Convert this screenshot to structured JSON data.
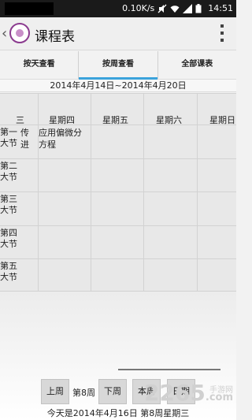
{
  "status_bar": {
    "speed": "0.10K/s",
    "time": "14:51"
  },
  "header": {
    "title": "课程表"
  },
  "tabs": [
    {
      "label": "按天查看"
    },
    {
      "label": "按周查看"
    },
    {
      "label": "全部课表"
    }
  ],
  "date_range": "2014年4月14日~2014年4月20日",
  "schedule": {
    "days": [
      "三",
      "星期四",
      "星期五",
      "星期六",
      "星期日"
    ],
    "periods": [
      {
        "line1": "第一",
        "line2": "大节"
      },
      {
        "line1": "第二",
        "line2": "大节"
      },
      {
        "line1": "第三",
        "line2": "大节"
      },
      {
        "line1": "第四",
        "line2": "大节"
      },
      {
        "line1": "第五",
        "line2": "大节"
      }
    ],
    "cells": {
      "wednesday_p1": {
        "line1": "传",
        "line2": "进"
      },
      "thursday_p1": {
        "line1": "应用偏微分",
        "line2": "方程"
      }
    }
  },
  "controls": {
    "prev_week": "上周",
    "current_week": "第8周",
    "next_week": "下周",
    "this_week": "本周",
    "date": "日期"
  },
  "today_text": "今天是2014年4月16日 第8周星期三",
  "watermark": {
    "main": "2265",
    "sub": "手游网",
    "tail": ".com"
  }
}
